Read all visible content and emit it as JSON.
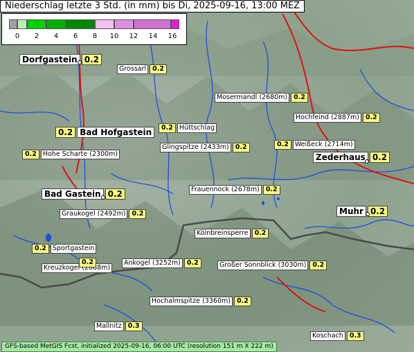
{
  "title": "Niederschlag letzte 3 Std. (in mm) bis Di, 2025-09-16, 13:00 MEZ",
  "legend": {
    "ticks": [
      "0",
      "2",
      "4",
      "6",
      "8",
      "10",
      "12",
      "14",
      "16"
    ],
    "colors": [
      "#a0a0a0",
      "#b8f0b8",
      "#00d000",
      "#00b000",
      "#008800",
      "#f0c0f0",
      "#e090e0",
      "#d070d0",
      "#e020d0"
    ]
  },
  "stations": [
    {
      "name": "Dorfgastein",
      "value": "0.2",
      "town": true
    },
    {
      "name": "Grossarl",
      "value": "0.2",
      "town": false
    },
    {
      "name": "Mosermandl (2680m)",
      "value": "0.2",
      "town": false
    },
    {
      "name": "Hochfeind (2887m)",
      "value": "0.2",
      "town": false
    },
    {
      "name": "Bad Hofgastein",
      "value": "0.2",
      "town": true
    },
    {
      "name": "Hüttschlag",
      "value": "0.2",
      "town": false
    },
    {
      "name": "Hohe Scharte (2300m)",
      "value": "0.2",
      "town": false
    },
    {
      "name": "Glingspitze (2433m)",
      "value": "0.2",
      "town": false
    },
    {
      "name": "Weißeck (2714m)",
      "value": "0.2",
      "town": false
    },
    {
      "name": "Zederhaus",
      "value": "0.2",
      "town": true
    },
    {
      "name": "Bad Gastein",
      "value": "0.2",
      "town": true
    },
    {
      "name": "Frauennock (2678m)",
      "value": "0.2",
      "town": false
    },
    {
      "name": "Graukogel (2492m)",
      "value": "0.2",
      "town": false
    },
    {
      "name": "Muhr",
      "value": "0.2",
      "town": true
    },
    {
      "name": "Kölnbreinsperre",
      "value": "0.2",
      "town": false
    },
    {
      "name": "Sportgastein",
      "value": "0.2",
      "town": false
    },
    {
      "name": "Kreuzkogel (2688m)",
      "value": "0.2",
      "town": false
    },
    {
      "name": "Ankogel (3252m)",
      "value": "0.2",
      "town": false
    },
    {
      "name": "Großer Sonnblick (3030m)",
      "value": "0.2",
      "town": false
    },
    {
      "name": "Hochalmspitze (3360m)",
      "value": "0.2",
      "town": false
    },
    {
      "name": "Mallnitz",
      "value": "0.3",
      "town": false
    },
    {
      "name": "Koschach",
      "value": "0.3",
      "town": false
    }
  ],
  "footer": "GFS-based MetGIS Fcst, initialized 2025-09-16, 06:00 UTC  (resolution 151 m X 222 m)"
}
